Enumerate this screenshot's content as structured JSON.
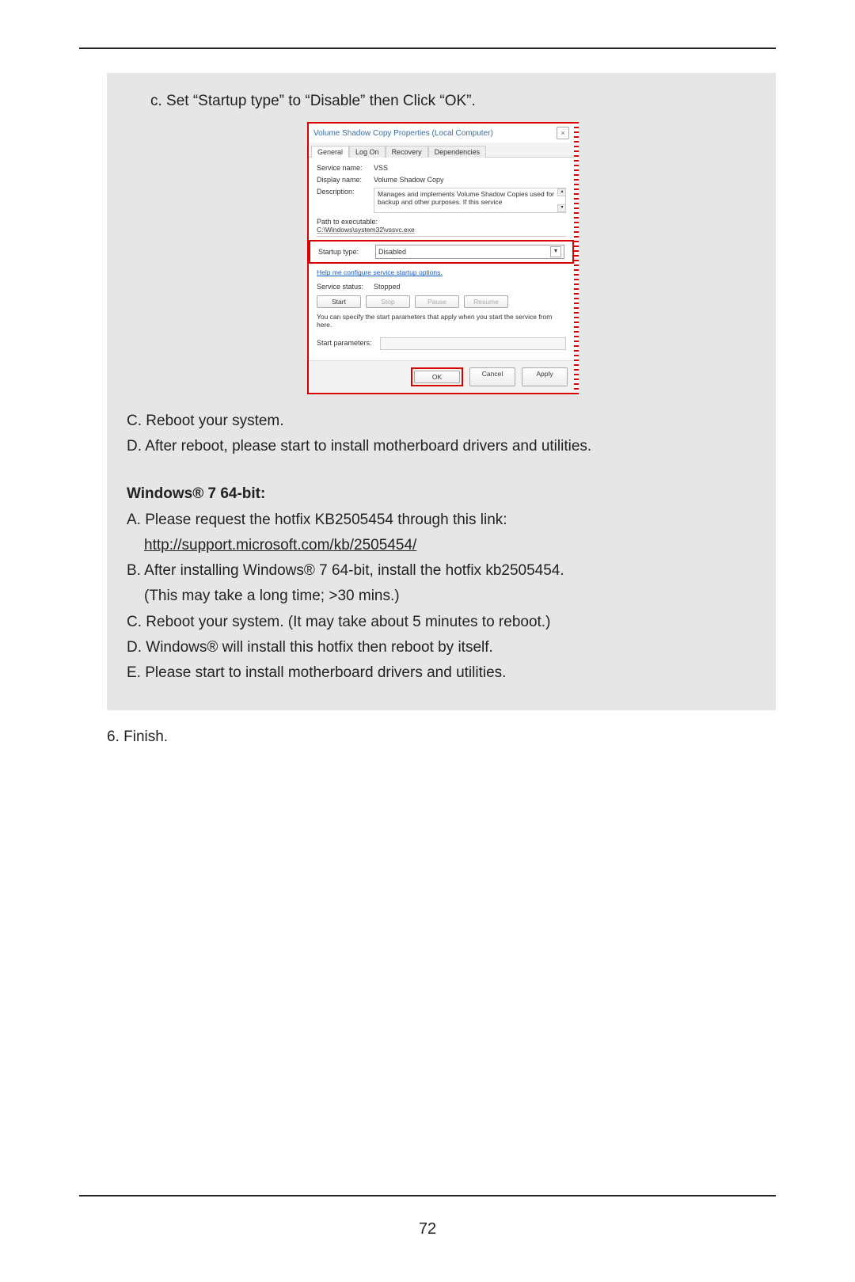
{
  "page_number": "72",
  "box": {
    "step_c": "c. Set “Startup type” to “Disable” then Click “OK”.",
    "C_text": "C. Reboot your system.",
    "D_text": "D. After reboot, please start to install motherboard drivers and utilities.",
    "heading": "Windows® 7 64-bit:",
    "A1": "A. Please request the hotfix KB2505454 through this link:",
    "A2": "http://support.microsoft.com/kb/2505454/",
    "B1": "B. After installing Windows® 7 64-bit, install the hotfix kb2505454.",
    "B2": "(This may take a long time; >30 mins.)",
    "C2": "C. Reboot your system. (It may take about 5 minutes to reboot.)",
    "D2": "D. Windows® will install this hotfix then reboot by itself.",
    "E2": "E. Please start to install motherboard drivers and utilities."
  },
  "finish": "6. Finish.",
  "dialog": {
    "title": "Volume Shadow Copy Properties (Local Computer)",
    "close": "×",
    "tabs": [
      "General",
      "Log On",
      "Recovery",
      "Dependencies"
    ],
    "service_name_lbl": "Service name:",
    "service_name_val": "VSS",
    "display_name_lbl": "Display name:",
    "display_name_val": "Volume Shadow Copy",
    "description_lbl": "Description:",
    "description_val": "Manages and implements Volume Shadow Copies used for backup and other purposes. If this service",
    "path_lbl": "Path to executable:",
    "path_val": "C:\\Windows\\system32\\vssvc.exe",
    "startup_lbl": "Startup type:",
    "startup_val": "Disabled",
    "help_link": "Help me configure service startup options.",
    "status_lbl": "Service status:",
    "status_val": "Stopped",
    "btn_start": "Start",
    "btn_stop": "Stop",
    "btn_pause": "Pause",
    "btn_resume": "Resume",
    "note": "You can specify the start parameters that apply when you start the service from here.",
    "params_lbl": "Start parameters:",
    "btn_ok": "OK",
    "btn_cancel": "Cancel",
    "btn_apply": "Apply"
  }
}
